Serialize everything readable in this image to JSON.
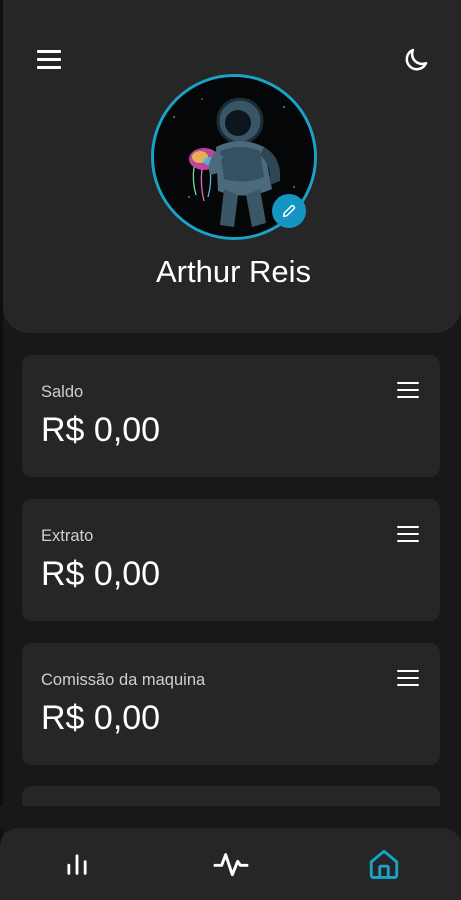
{
  "header": {
    "menu_icon": "menu-icon",
    "theme_icon": "moon-icon",
    "user_name": "Arthur Reis",
    "edit_icon": "pencil-icon",
    "accent_color": "#1aa3c9"
  },
  "cards": [
    {
      "label": "Saldo",
      "value": "R$ 0,00",
      "icon": "menu-icon"
    },
    {
      "label": "Extrato",
      "value": "R$ 0,00",
      "icon": "menu-icon"
    },
    {
      "label": "Comissão da maquina",
      "value": "R$ 0,00",
      "icon": "menu-icon"
    }
  ],
  "bottom_nav": {
    "items": [
      {
        "icon": "bar-chart-icon",
        "active": false
      },
      {
        "icon": "activity-icon",
        "active": false
      },
      {
        "icon": "home-icon",
        "active": true
      }
    ],
    "active_color": "#1aa3c9"
  }
}
